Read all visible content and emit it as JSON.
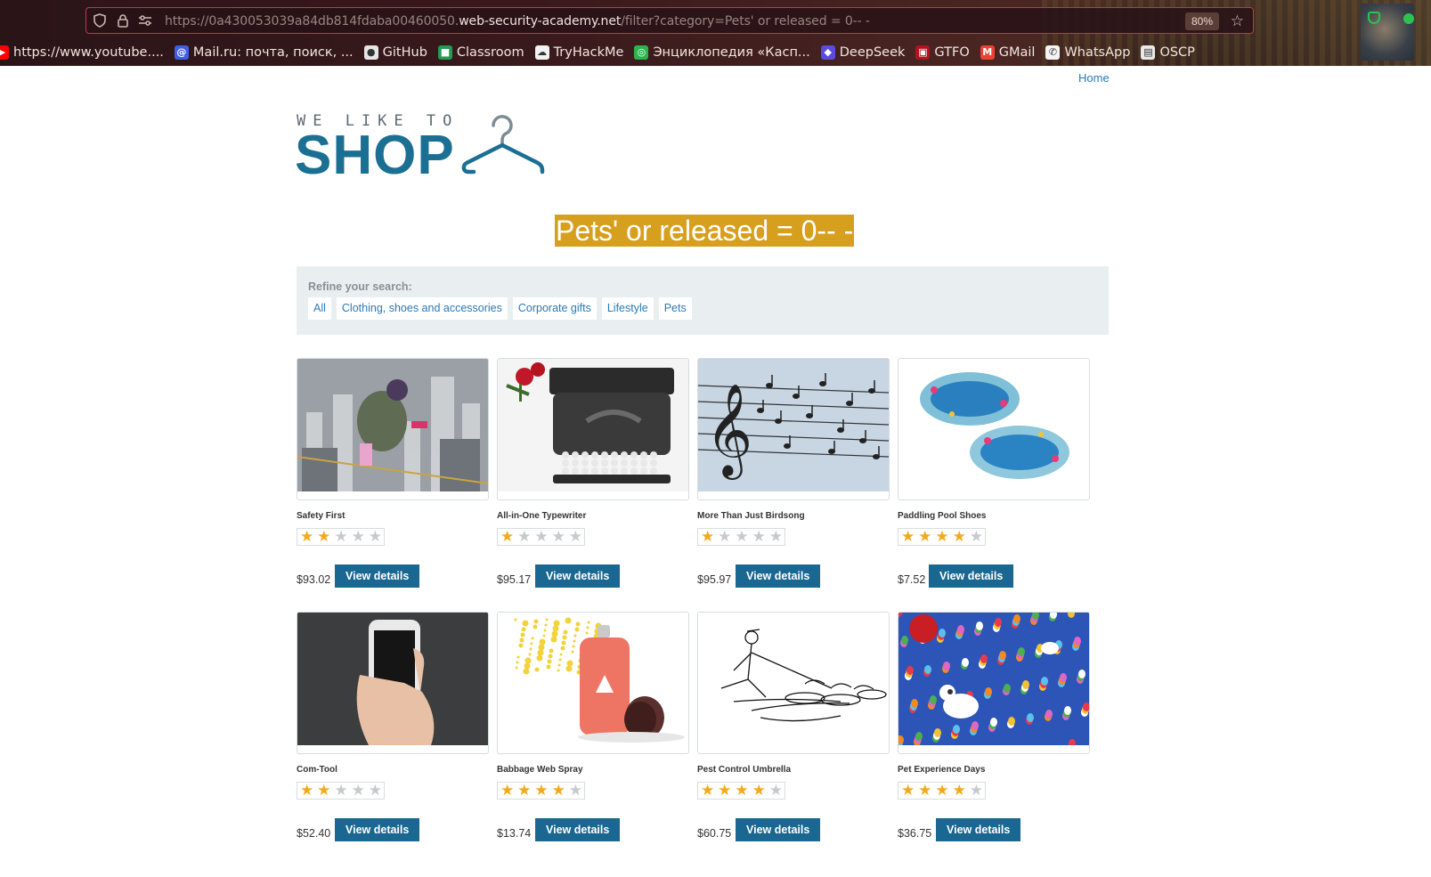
{
  "browser": {
    "url_prefix": "https://0a430053039a84db814fdaba00460050.",
    "url_domain": "web-security-academy.net",
    "url_path": "/filter?category=Pets' or released = 0-- -",
    "zoom": "80%",
    "bookmarks": [
      {
        "label": "https://www.youtube....",
        "icon": "youtube-icon",
        "color": "#ff0000"
      },
      {
        "label": "Mail.ru: почта, поиск, ...",
        "icon": "mailru-icon",
        "color": "#3f5ee8"
      },
      {
        "label": "GitHub",
        "icon": "github-icon",
        "color": "#e6e6e6"
      },
      {
        "label": "Classroom",
        "icon": "classroom-icon",
        "color": "#1f9d55"
      },
      {
        "label": "TryHackMe",
        "icon": "tryhackme-icon",
        "color": "#f2f2f2"
      },
      {
        "label": "Энциклопедия «Касп...",
        "icon": "globe-icon",
        "color": "#2db34a"
      },
      {
        "label": "DeepSeek",
        "icon": "deepseek-icon",
        "color": "#5b4be0"
      },
      {
        "label": "GTFO",
        "icon": "gtfo-icon",
        "color": "#b3121f"
      },
      {
        "label": "GMail",
        "icon": "gmail-icon",
        "color": "#ea4335"
      },
      {
        "label": "WhatsApp",
        "icon": "whatsapp-icon",
        "color": "#f4f4f4"
      },
      {
        "label": "OSCP",
        "icon": "oscp-icon",
        "color": "#e9e9e9"
      }
    ]
  },
  "nav": {
    "home": "Home"
  },
  "logo": {
    "tagline": "WE LIKE TO",
    "word": "SHOP"
  },
  "heading": "Pets' or released = 0-- -",
  "filters": {
    "label": "Refine your search:",
    "categories": [
      "All",
      "Clothing, shoes and accessories",
      "Corporate gifts",
      "Lifestyle",
      "Pets"
    ]
  },
  "colors": {
    "accent": "#1a6791",
    "heading_bg": "#d79f1e",
    "star": "#f4a91b",
    "link": "#2a7ab8"
  },
  "products": [
    {
      "name": "Safety First",
      "rating": 2,
      "price": "$93.02",
      "button": "View details",
      "image": "climber"
    },
    {
      "name": "All-in-One Typewriter",
      "rating": 1,
      "price": "$95.17",
      "button": "View details",
      "image": "typewriter"
    },
    {
      "name": "More Than Just Birdsong",
      "rating": 1,
      "price": "$95.97",
      "button": "View details",
      "image": "birdsong"
    },
    {
      "name": "Paddling Pool Shoes",
      "rating": 4,
      "price": "$7.52",
      "button": "View details",
      "image": "pools"
    },
    {
      "name": "Com-Tool",
      "rating": 2,
      "price": "$52.40",
      "button": "View details",
      "image": "phone"
    },
    {
      "name": "Babbage Web Spray",
      "rating": 4,
      "price": "$13.74",
      "button": "View details",
      "image": "spray"
    },
    {
      "name": "Pest Control Umbrella",
      "rating": 4,
      "price": "$60.75",
      "button": "View details",
      "image": "umbrella"
    },
    {
      "name": "Pet Experience Days",
      "rating": 4,
      "price": "$36.75",
      "button": "View details",
      "image": "balloons"
    }
  ]
}
